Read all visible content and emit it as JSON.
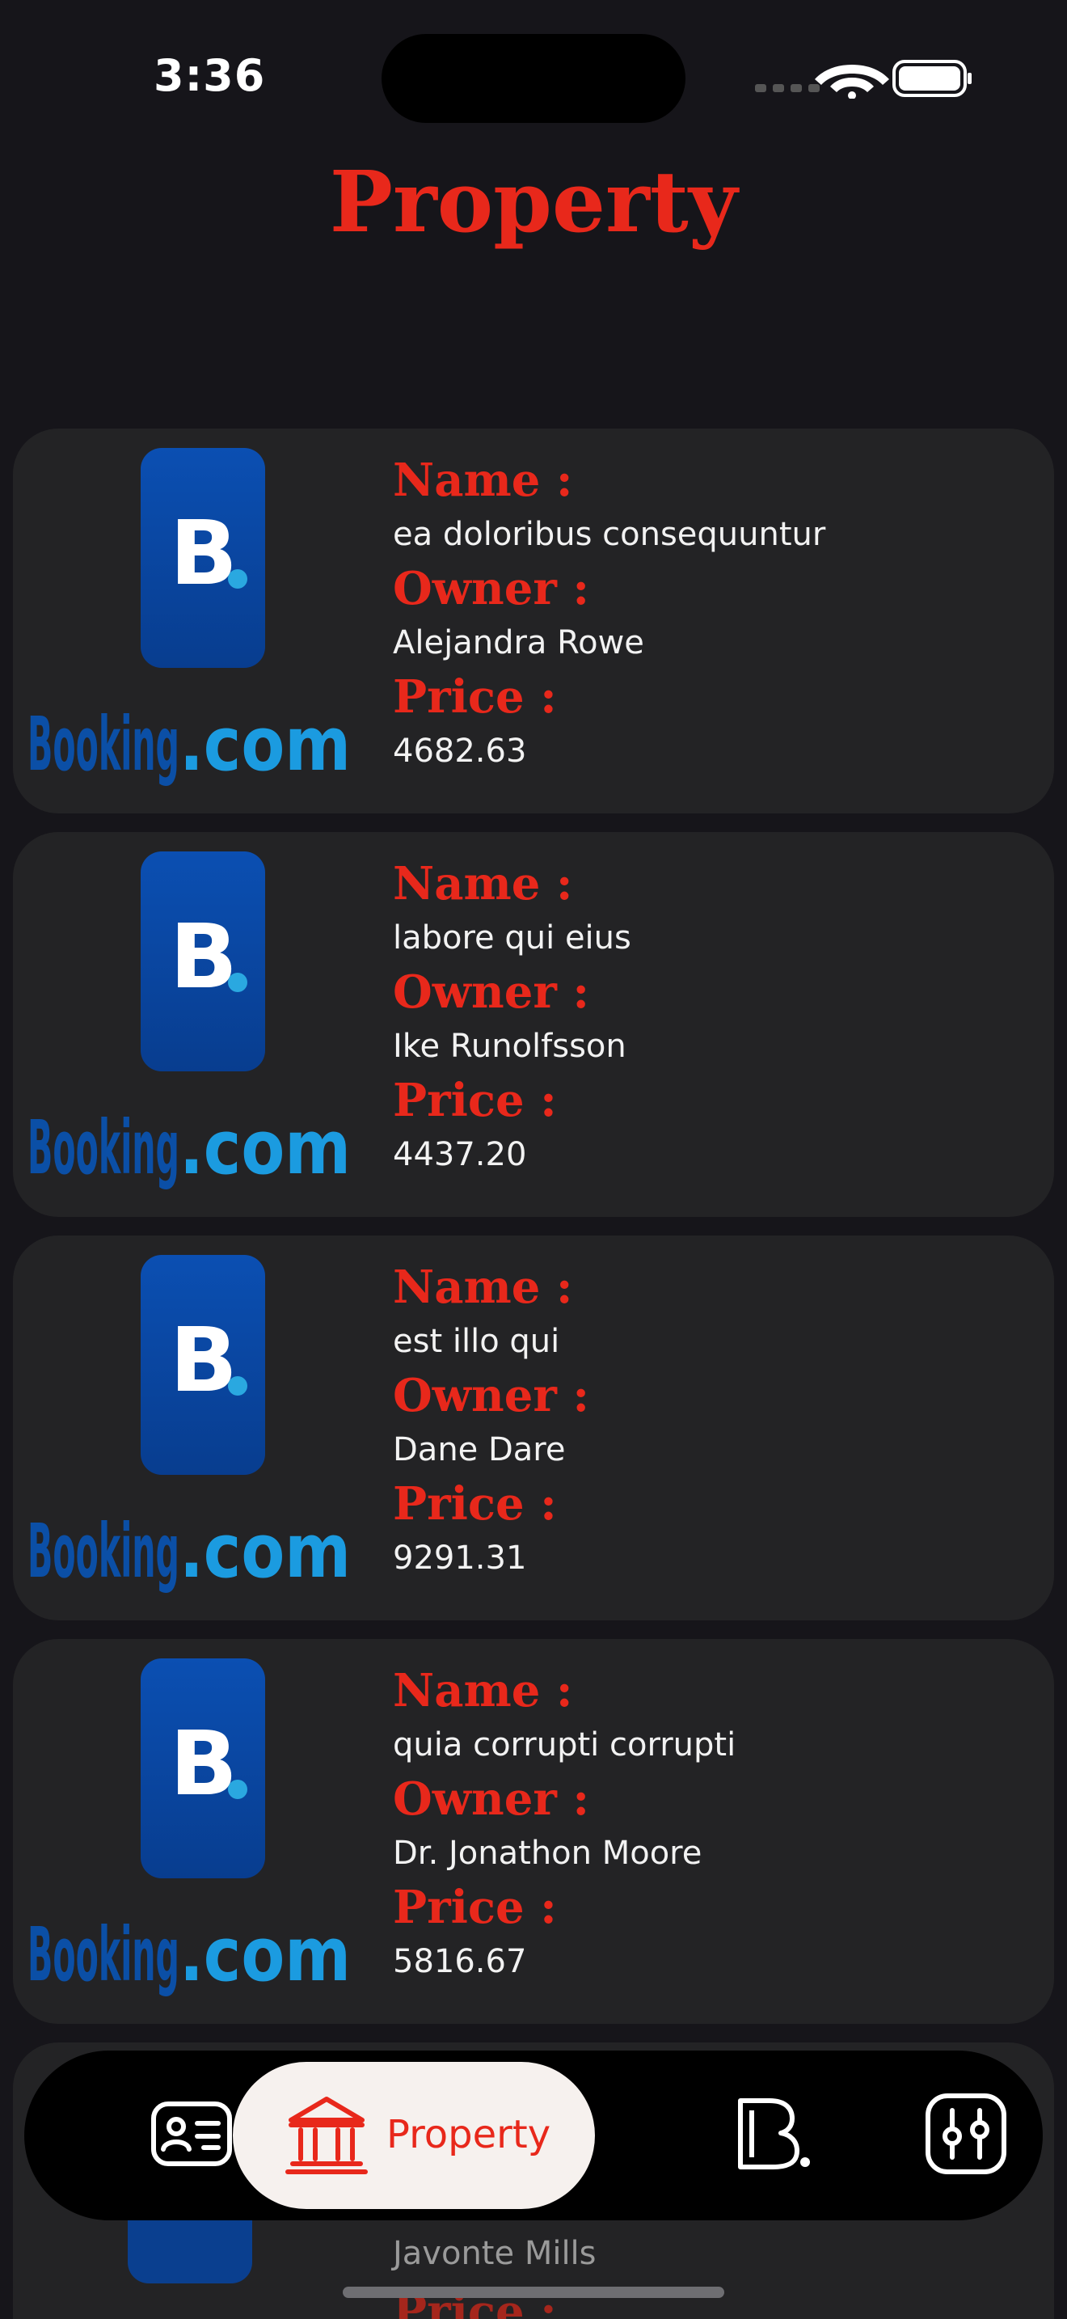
{
  "status_bar": {
    "time": "3:36"
  },
  "page": {
    "title": "Property"
  },
  "labels": {
    "name": "Name :",
    "owner": "Owner :",
    "price": "Price :"
  },
  "properties": [
    {
      "name": "ea doloribus consequuntur",
      "owner": "Alejandra Rowe",
      "price": "4682.63",
      "logo": "booking-logo"
    },
    {
      "name": "labore qui eius",
      "owner": "Ike Runolfsson",
      "price": "4437.20",
      "logo": "booking-logo"
    },
    {
      "name": "est illo qui",
      "owner": "Dane Dare",
      "price": "9291.31",
      "logo": "booking-logo"
    },
    {
      "name": "quia corrupti corrupti",
      "owner": "Dr. Jonathon Moore",
      "price": "5816.67",
      "logo": "booking-logo"
    },
    {
      "owner": "Javonte Mills",
      "logo": "booking-logo"
    }
  ],
  "tabbar": {
    "items": [
      {
        "icon": "id-card-icon"
      },
      {
        "icon": "bank-icon",
        "label": "Property",
        "active": true
      },
      {
        "icon": "booking-b-icon"
      },
      {
        "icon": "sliders-icon"
      }
    ]
  },
  "colors": {
    "accent": "#e8281b",
    "background": "#16151a",
    "card": "#232325"
  }
}
